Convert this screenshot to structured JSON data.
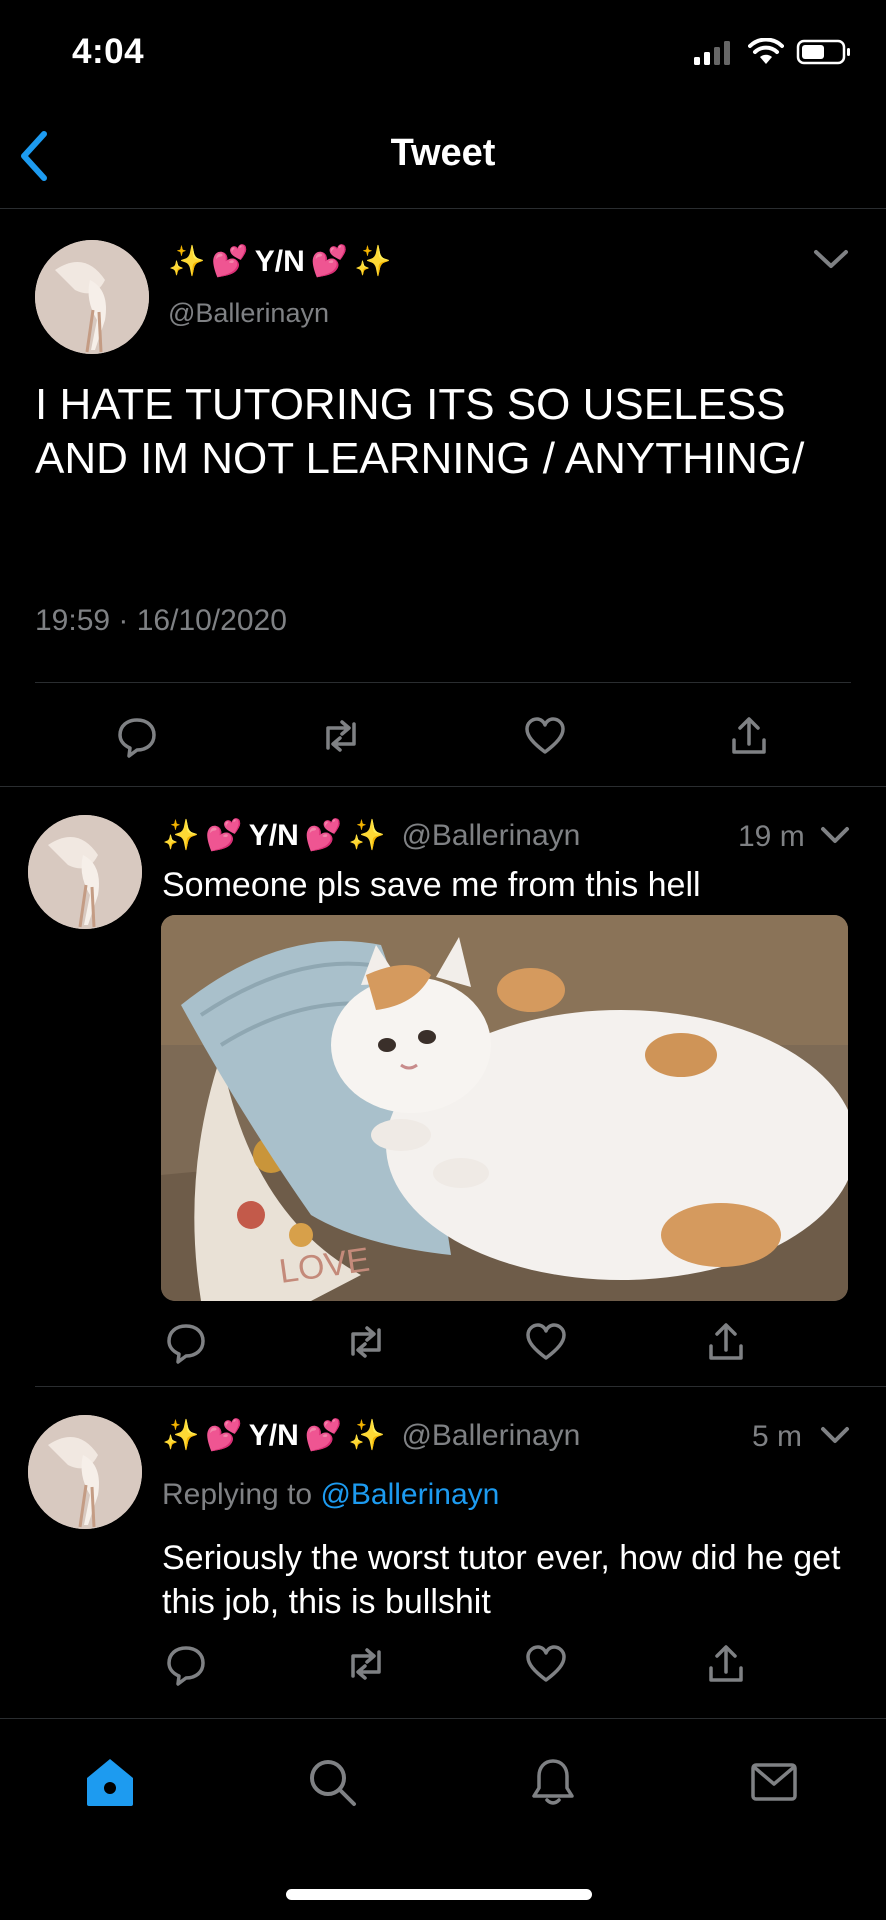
{
  "status": {
    "time": "4:04"
  },
  "header": {
    "title": "Tweet"
  },
  "main_tweet": {
    "display_name": "Y/N",
    "handle": "@Ballerinayn",
    "text": "I HATE TUTORING ITS SO USELESS AND IM NOT LEARNING / ANYTHING/",
    "timestamp": "19:59 · 16/10/2020"
  },
  "replies": [
    {
      "display_name": "Y/N",
      "handle": "@Ballerinayn",
      "time": "19 m",
      "text": "Someone pls save me from this hell",
      "image_text": "LOVE"
    },
    {
      "display_name": "Y/N",
      "handle": "@Ballerinayn",
      "time": "5 m",
      "replying_prefix": "Replying to",
      "replying_to": "@Ballerinayn",
      "text": "Seriously the worst tutor ever, how did he get this job, this is bullshit"
    }
  ],
  "icons": {
    "back": "chevron-left-icon",
    "menu": "chevron-down-icon",
    "reply": "reply-icon",
    "retweet": "retweet-icon",
    "like": "heart-icon",
    "share": "share-icon",
    "home": "home-icon",
    "search": "search-icon",
    "notifications": "bell-icon",
    "messages": "mail-icon"
  },
  "colors": {
    "accent": "#1d9bf0",
    "background": "#000000",
    "muted": "#7f8184"
  }
}
